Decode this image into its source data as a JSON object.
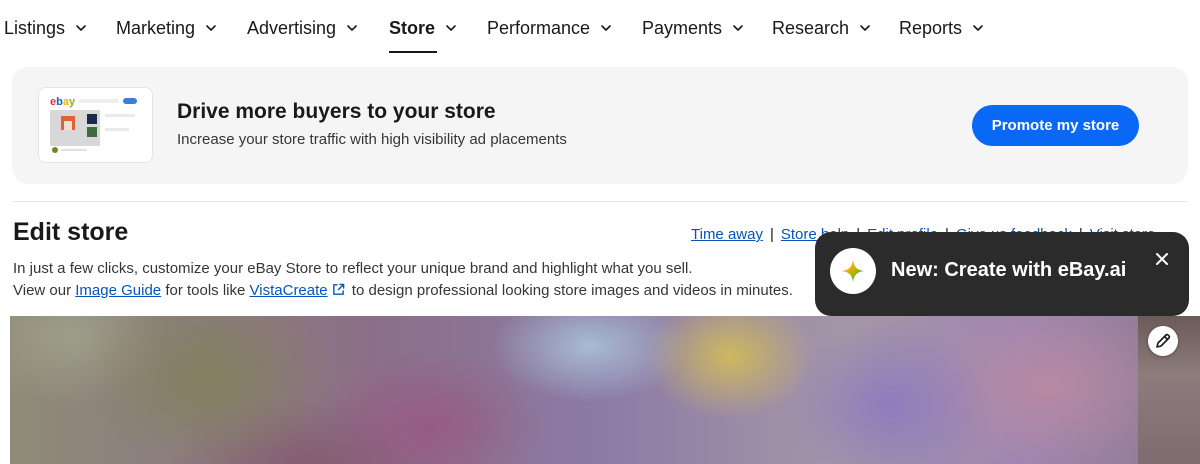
{
  "nav": {
    "items": [
      {
        "label": "Listings",
        "active": false
      },
      {
        "label": "Marketing",
        "active": false
      },
      {
        "label": "Advertising",
        "active": false
      },
      {
        "label": "Store",
        "active": true
      },
      {
        "label": "Performance",
        "active": false
      },
      {
        "label": "Payments",
        "active": false
      },
      {
        "label": "Research",
        "active": false
      },
      {
        "label": "Reports",
        "active": false
      }
    ],
    "chevron_icon": "chevron-down-icon"
  },
  "promo": {
    "title": "Drive more buyers to your store",
    "subtitle": "Increase your store traffic with high visibility ad placements",
    "button_label": "Promote my store",
    "thumb_logo": "ebay",
    "button_color": "#0968f6"
  },
  "edit_store": {
    "title": "Edit store",
    "links": [
      "Time away",
      "Store help",
      "Edit profile",
      "Give us feedback",
      "Visit store"
    ],
    "desc_line1": "In just a few clicks, customize your eBay Store to reflect your unique brand and highlight what you sell.",
    "desc_line2_prefix": "View our ",
    "image_guide_link": "Image Guide",
    "desc_line2_mid": " for tools like ",
    "vistacreate_link": "VistaCreate",
    "desc_line2_suffix": " to design professional looking store images and videos in minutes.",
    "link_color": "#0654ba"
  },
  "cover": {
    "edit_icon": "pencil-icon"
  },
  "tooltip": {
    "text": "New: Create with eBay.ai",
    "icon": "sparkle-icon",
    "close_icon": "close-icon",
    "background": "#2b2b2b"
  }
}
